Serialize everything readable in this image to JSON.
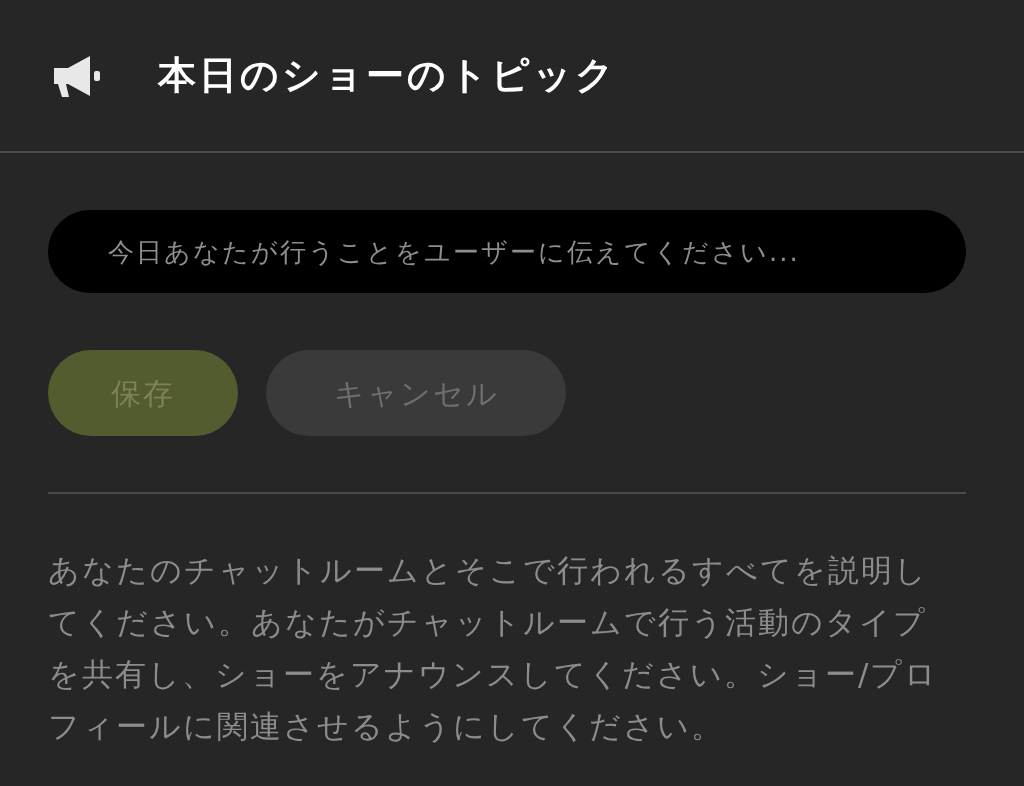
{
  "header": {
    "title": "本日のショーのトピック"
  },
  "topic_field": {
    "placeholder": "今日あなたが行うことをユーザーに伝えてください..."
  },
  "buttons": [
    {
      "kind": "primary",
      "label": "保存",
      "disabled": true
    },
    {
      "kind": "secondary",
      "label": "キャンセル",
      "disabled": true
    }
  ],
  "description": "あなたのチャットルームとそこで行われるすべてを説明してください。あなたがチャットルームで行う活動のタイプを共有し、ショーをアナウンスしてください。ショー/プロフィールに関連させるようにしてください。"
}
